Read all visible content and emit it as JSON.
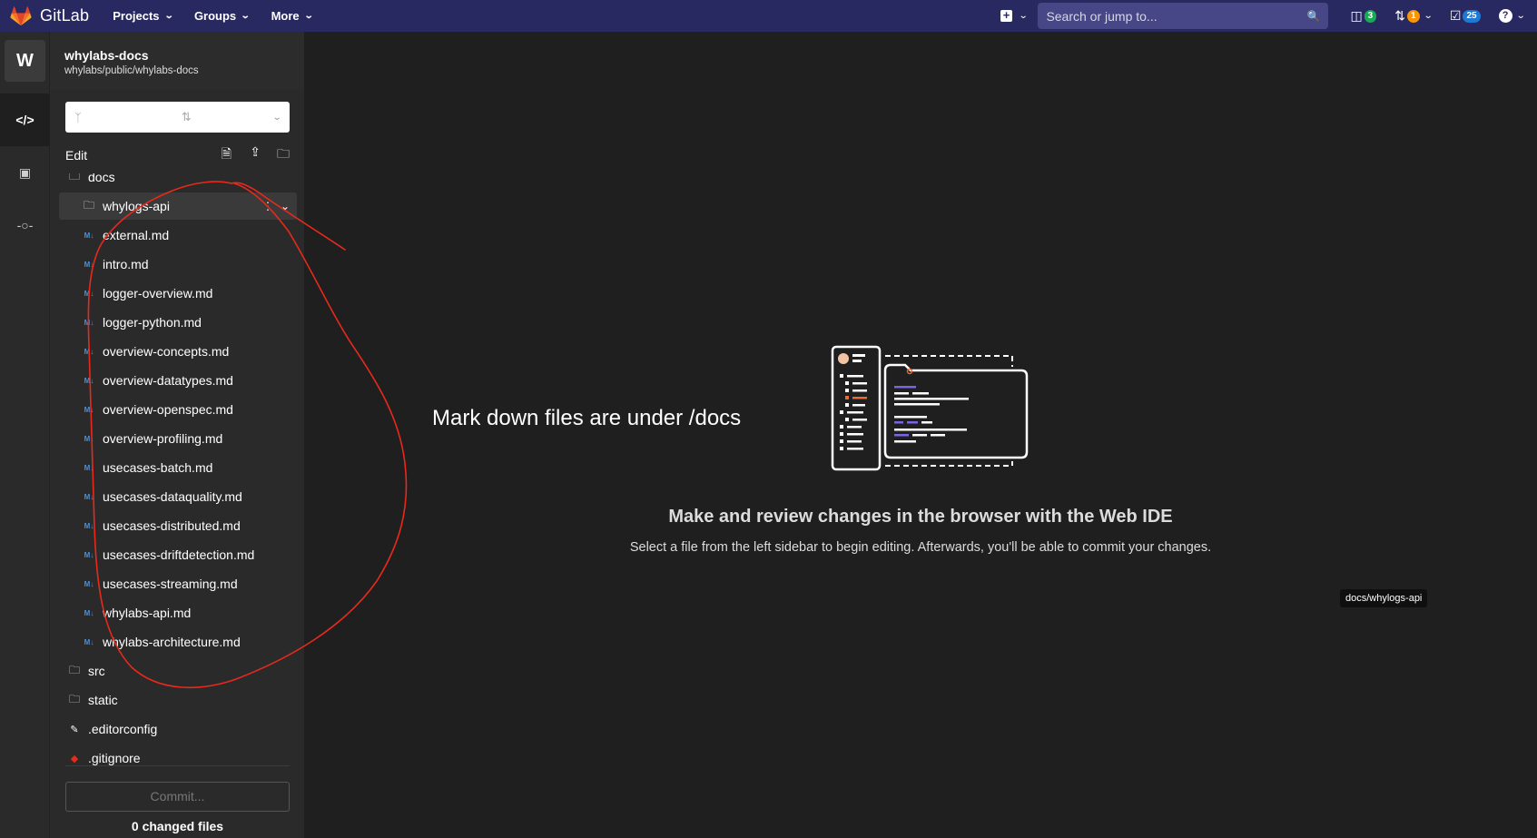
{
  "navbar": {
    "brand": "GitLab",
    "menu": [
      {
        "label": "Projects"
      },
      {
        "label": "Groups"
      },
      {
        "label": "More"
      }
    ],
    "search_placeholder": "Search or jump to...",
    "badges": {
      "issues": "3",
      "merge_requests": "1",
      "todos": "25"
    }
  },
  "project": {
    "avatar_letter": "W",
    "name": "whylabs-docs",
    "path": "whylabs/public/whylabs-docs"
  },
  "sidebar": {
    "edit_label": "Edit",
    "tree": [
      {
        "name": "docs",
        "type": "folder",
        "depth": 0
      },
      {
        "name": "whylogs-api",
        "type": "folder",
        "depth": 1,
        "selected": true
      },
      {
        "name": "external.md",
        "type": "md",
        "depth": 1
      },
      {
        "name": "intro.md",
        "type": "md",
        "depth": 1
      },
      {
        "name": "logger-overview.md",
        "type": "md",
        "depth": 1
      },
      {
        "name": "logger-python.md",
        "type": "md",
        "depth": 1
      },
      {
        "name": "overview-concepts.md",
        "type": "md",
        "depth": 1
      },
      {
        "name": "overview-datatypes.md",
        "type": "md",
        "depth": 1
      },
      {
        "name": "overview-openspec.md",
        "type": "md",
        "depth": 1
      },
      {
        "name": "overview-profiling.md",
        "type": "md",
        "depth": 1
      },
      {
        "name": "usecases-batch.md",
        "type": "md",
        "depth": 1
      },
      {
        "name": "usecases-dataquality.md",
        "type": "md",
        "depth": 1
      },
      {
        "name": "usecases-distributed.md",
        "type": "md",
        "depth": 1
      },
      {
        "name": "usecases-driftdetection.md",
        "type": "md",
        "depth": 1
      },
      {
        "name": "usecases-streaming.md",
        "type": "md",
        "depth": 1
      },
      {
        "name": "whylabs-api.md",
        "type": "md",
        "depth": 1
      },
      {
        "name": "whylabs-architecture.md",
        "type": "md",
        "depth": 1
      },
      {
        "name": "src",
        "type": "folder",
        "depth": 0
      },
      {
        "name": "static",
        "type": "folder",
        "depth": 0
      },
      {
        "name": ".editorconfig",
        "type": "config",
        "depth": 0
      },
      {
        "name": ".gitignore",
        "type": "git",
        "depth": 0
      }
    ],
    "commit_label": "Commit...",
    "changed_files": "0 changed files"
  },
  "main": {
    "annotation": "Mark down files are under /docs",
    "empty_title": "Make and review changes in the browser with the Web IDE",
    "empty_subtitle": "Select a file from the left sidebar to begin editing. Afterwards, you'll be able to commit your changes.",
    "tooltip": "docs/whylogs-api"
  },
  "colors": {
    "navbar": "#292961",
    "accent_green": "#1aaa55",
    "accent_orange": "#fc9403",
    "accent_blue": "#1f78d1",
    "annotation_red": "#e8291c"
  }
}
